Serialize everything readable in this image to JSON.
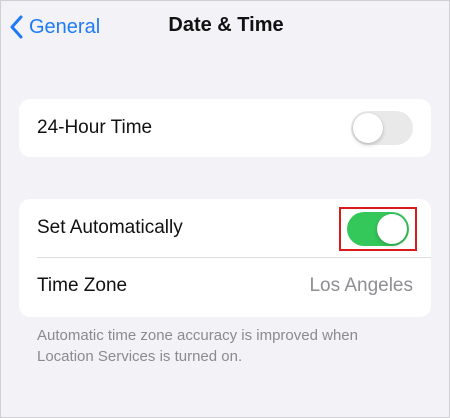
{
  "nav": {
    "back_label": "General",
    "title": "Date & Time"
  },
  "group1": {
    "rows": [
      {
        "label": "24-Hour Time",
        "toggle": "off"
      }
    ]
  },
  "group2": {
    "rows": [
      {
        "label": "Set Automatically",
        "toggle": "on"
      },
      {
        "label": "Time Zone",
        "value": "Los Angeles"
      }
    ],
    "footer": "Automatic time zone accuracy is improved when Location Services is turned on."
  },
  "colors": {
    "accent": "#1f7bf5",
    "toggle_on": "#34c759",
    "highlight_border": "#d91b1b",
    "background": "#f2f2f7"
  },
  "icons": {
    "back": "chevron-left-icon"
  }
}
